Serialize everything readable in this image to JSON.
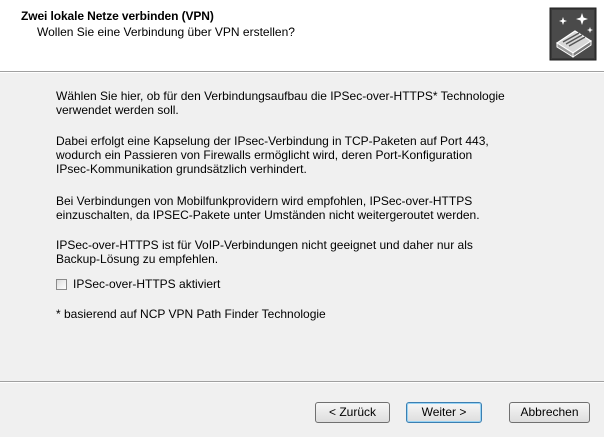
{
  "header": {
    "title": "Zwei lokale Netze verbinden (VPN)",
    "subtitle": "Wollen Sie eine Verbindung über VPN erstellen?",
    "icon": "network-wizard-icon"
  },
  "content": {
    "paragraph1": "Wählen Sie hier, ob für den Verbindungsaufbau die IPSec-over-HTTPS* Technologie verwendet werden soll.",
    "paragraph2_lines": [
      "Dabei erfolgt eine Kapselung der IPsec-Verbindung in TCP-Paketen auf Port 443,",
      "wodurch ein Passieren von Firewalls ermöglicht wird, deren Port-Konfiguration",
      "IPsec-Kommunikation grundsätzlich verhindert."
    ],
    "paragraph3_lines": [
      "Bei Verbindungen von Mobilfunkprovidern wird empfohlen, IPSec-over-HTTPS",
      "einzuschalten, da IPSEC-Pakete unter Umständen nicht weitergeroutet werden."
    ],
    "paragraph4_lines": [
      "IPSec-over-HTTPS ist für VoIP-Verbindungen nicht geeignet und daher nur als",
      "Backup-Lösung zu empfehlen."
    ],
    "paragraph1_lines": [
      "Wählen Sie hier, ob für den Verbindungsaufbau die IPSec-over-HTTPS* Technologie",
      "verwendet werden soll."
    ]
  },
  "checkbox": {
    "label": "IPSec-over-HTTPS aktiviert",
    "checked": false
  },
  "footnote": "* basierend auf NCP VPN Path Finder Technologie",
  "buttons": {
    "back": "< Zurück",
    "next": "Weiter >",
    "cancel": "Abbrechen"
  }
}
